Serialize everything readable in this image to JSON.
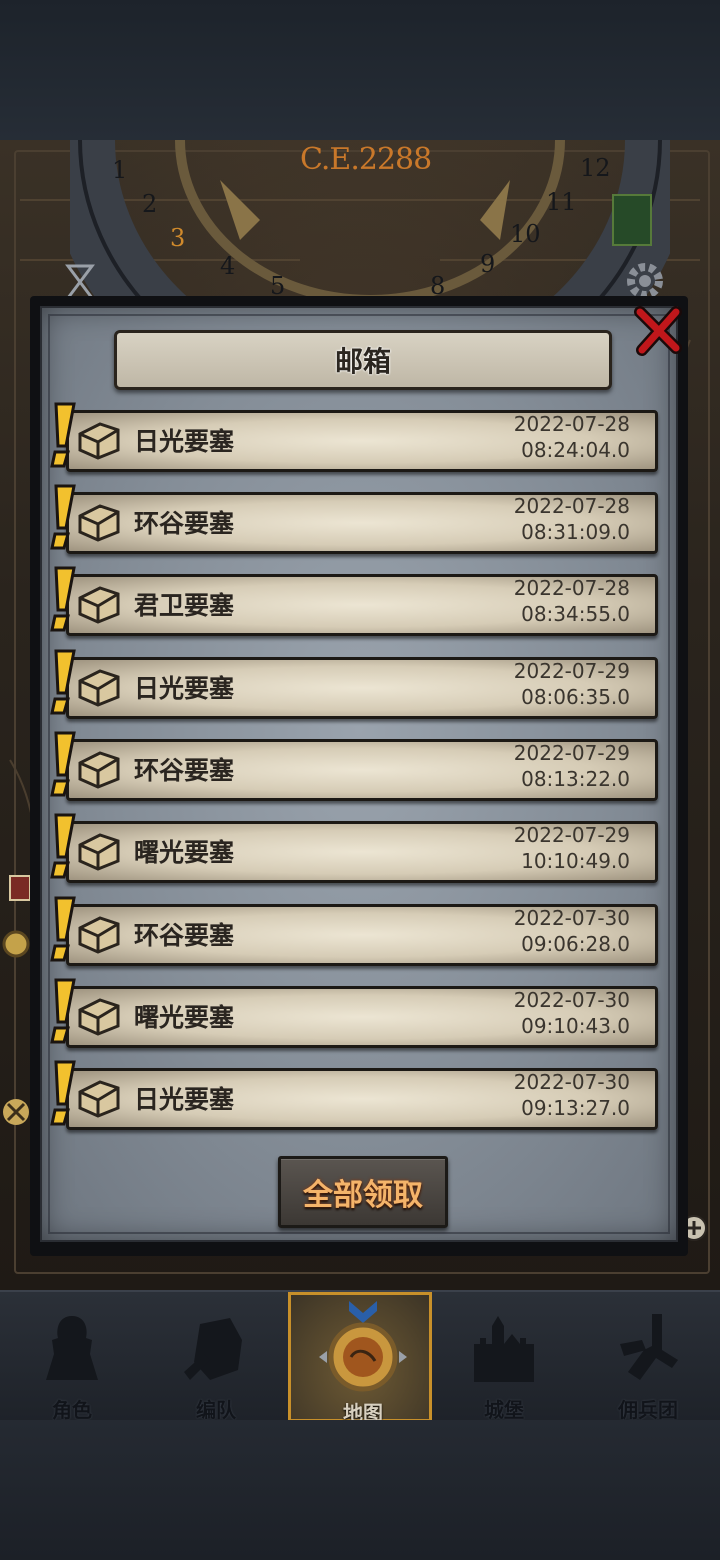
{
  "map": {
    "era_label": "C.E.2288",
    "dial_numbers_left": [
      "1",
      "2",
      "3",
      "4",
      "5"
    ],
    "dial_numbers_right": [
      "8",
      "9",
      "10",
      "11",
      "12"
    ]
  },
  "mailbox": {
    "title": "邮箱",
    "close_icon": "close-x-icon",
    "items": [
      {
        "title": "日光要塞",
        "date": "2022-07-28",
        "time": "08:24:04.0"
      },
      {
        "title": "环谷要塞",
        "date": "2022-07-28",
        "time": "08:31:09.0"
      },
      {
        "title": "君卫要塞",
        "date": "2022-07-28",
        "time": "08:34:55.0"
      },
      {
        "title": "日光要塞",
        "date": "2022-07-29",
        "time": "08:06:35.0"
      },
      {
        "title": "环谷要塞",
        "date": "2022-07-29",
        "time": "08:13:22.0"
      },
      {
        "title": "曙光要塞",
        "date": "2022-07-29",
        "time": "10:10:49.0"
      },
      {
        "title": "环谷要塞",
        "date": "2022-07-30",
        "time": "09:06:28.0"
      },
      {
        "title": "曙光要塞",
        "date": "2022-07-30",
        "time": "09:10:43.0"
      },
      {
        "title": "日光要塞",
        "date": "2022-07-30",
        "time": "09:13:27.0"
      }
    ],
    "claim_all_label": "全部领取"
  },
  "nav": {
    "items": [
      {
        "label": "角色",
        "icon": "knight-icon"
      },
      {
        "label": "编队",
        "icon": "helmet-icon"
      },
      {
        "label": "地图",
        "icon": "map-icon",
        "active": true
      },
      {
        "label": "城堡",
        "icon": "castle-icon"
      },
      {
        "label": "佣兵团",
        "icon": "mercenary-icon"
      }
    ]
  },
  "colors": {
    "accent_orange": "#f4b46a",
    "alert_yellow": "#f2c12e",
    "close_red": "#c0171b",
    "active_border": "#c8902a"
  }
}
